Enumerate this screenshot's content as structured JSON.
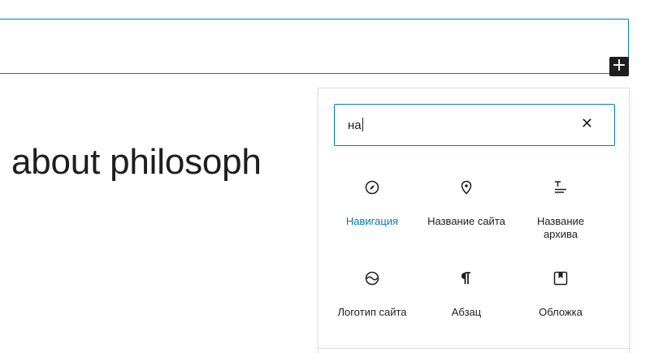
{
  "appender": {
    "symbol": "+"
  },
  "paragraph": {
    "text": "about philosoph"
  },
  "inserter": {
    "search": {
      "value": "на",
      "clear_symbol": "✕"
    },
    "blocks": [
      {
        "label": "Навигация",
        "icon": "compass-icon",
        "active": true
      },
      {
        "label": "Название сайта",
        "icon": "map-pin-icon"
      },
      {
        "label": "Название архива",
        "icon": "archive-title-icon"
      },
      {
        "label": "Логотип сайта",
        "icon": "site-logo-icon"
      },
      {
        "label": "Абзац",
        "icon": "paragraph-icon"
      },
      {
        "label": "Обложка",
        "icon": "cover-icon"
      }
    ]
  },
  "colors": {
    "accent": "#007cba",
    "text": "#1e1e1e",
    "border": "#e0e0e0"
  }
}
